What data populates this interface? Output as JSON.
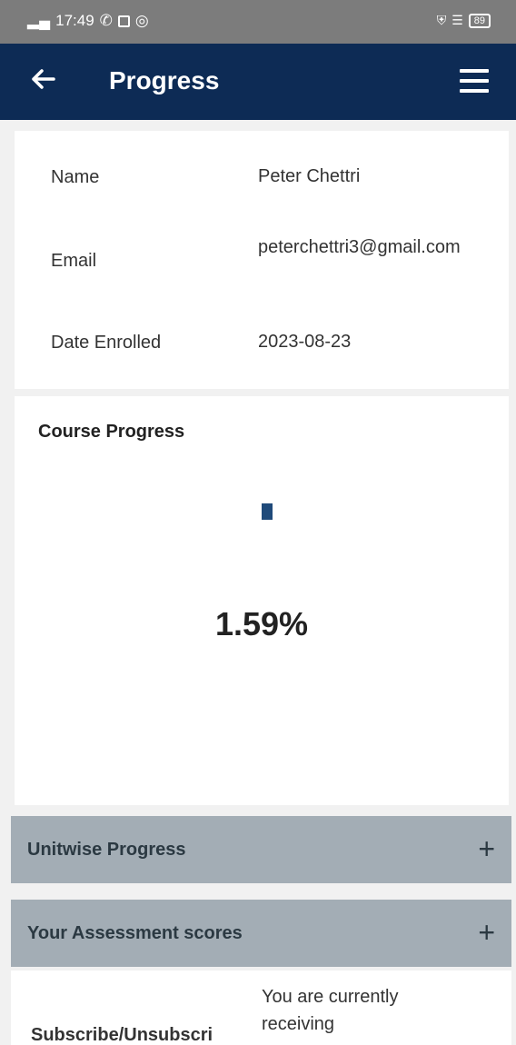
{
  "status_bar": {
    "time": "17:49",
    "signal": "▂▄",
    "call_icon": "✆",
    "battery": "89"
  },
  "app_bar": {
    "title": "Progress"
  },
  "profile": {
    "name_label": "Name",
    "name_value": "Peter Chettri",
    "email_label": "Email",
    "email_value": "peterchettri3@gmail.com",
    "date_label": "Date Enrolled",
    "date_value": "2023-08-23"
  },
  "course_progress": {
    "title": "Course Progress",
    "percent_text": "1.59%",
    "value": 0.0159,
    "bar_color": "#1f4a7a"
  },
  "accordions": [
    {
      "label": "Unitwise Progress",
      "icon": "+"
    },
    {
      "label": "Your Assessment scores",
      "icon": "+"
    }
  ],
  "subscription": {
    "label": "Subscribe/Unsubscri",
    "text": "You are currently receiving"
  },
  "colors": {
    "app_bar": "#0d2b55",
    "accordion": "#a3adb5",
    "status_bar": "#7c7c7c"
  }
}
